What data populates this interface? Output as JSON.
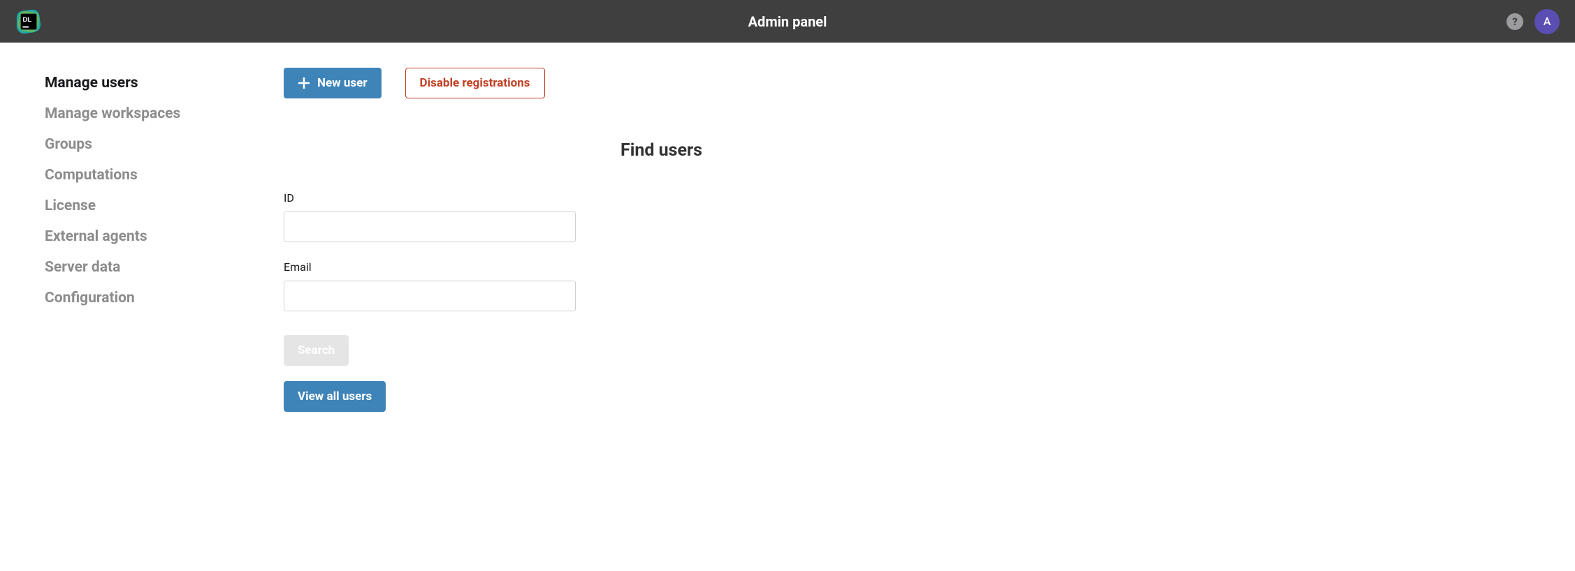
{
  "header": {
    "title": "Admin panel",
    "logo_text": "DL",
    "help_glyph": "?",
    "avatar_initial": "A"
  },
  "sidebar": {
    "items": [
      {
        "label": "Manage users",
        "active": true
      },
      {
        "label": "Manage workspaces",
        "active": false
      },
      {
        "label": "Groups",
        "active": false
      },
      {
        "label": "Computations",
        "active": false
      },
      {
        "label": "License",
        "active": false
      },
      {
        "label": "External agents",
        "active": false
      },
      {
        "label": "Server data",
        "active": false
      },
      {
        "label": "Configuration",
        "active": false
      }
    ]
  },
  "main": {
    "new_user_label": "New user",
    "disable_registrations_label": "Disable registrations",
    "section_title": "Find users",
    "form": {
      "id_label": "ID",
      "id_value": "",
      "email_label": "Email",
      "email_value": "",
      "search_label": "Search",
      "view_all_label": "View all users"
    }
  }
}
